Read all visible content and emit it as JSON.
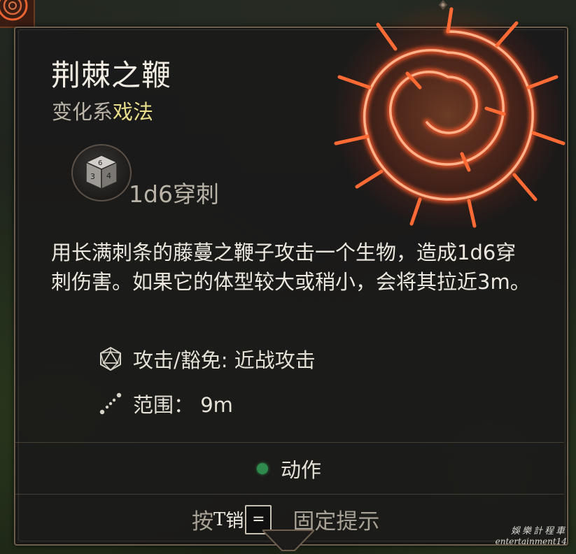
{
  "spell": {
    "title": "荆棘之鞭",
    "school": "变化系",
    "level": "戏法",
    "damage": "1d6穿刺",
    "description": "用长满刺条的藤蔓之鞭子攻击一个生物，造成1d6穿刺伤害。如果它的体型较大或稍小，会将其拉近3m。",
    "attack_save": "攻击/豁免: 近战攻击",
    "range": "范围：  9m",
    "action_cost": "动作"
  },
  "hint": {
    "prefix": "按",
    "key_letter": "T",
    "overlap_char": "销",
    "key_cap": "=",
    "suffix": "固定提示"
  },
  "watermark": {
    "line1": "娛樂計程車",
    "line2": "entertainment14"
  },
  "icons": {
    "spell_art": "thorn-spiral-sigil-icon",
    "corner": "spell-slot-thumbnail-icon",
    "dice": "d6-dice-icon",
    "attack": "d20-icosahedron-icon",
    "range": "dotted-line-range-icon",
    "action": "green-action-dot-icon"
  },
  "colors": {
    "school_highlight": "#e8dd8a",
    "sigil": "#ff5a2a",
    "action_dot": "#2f8a4e"
  }
}
